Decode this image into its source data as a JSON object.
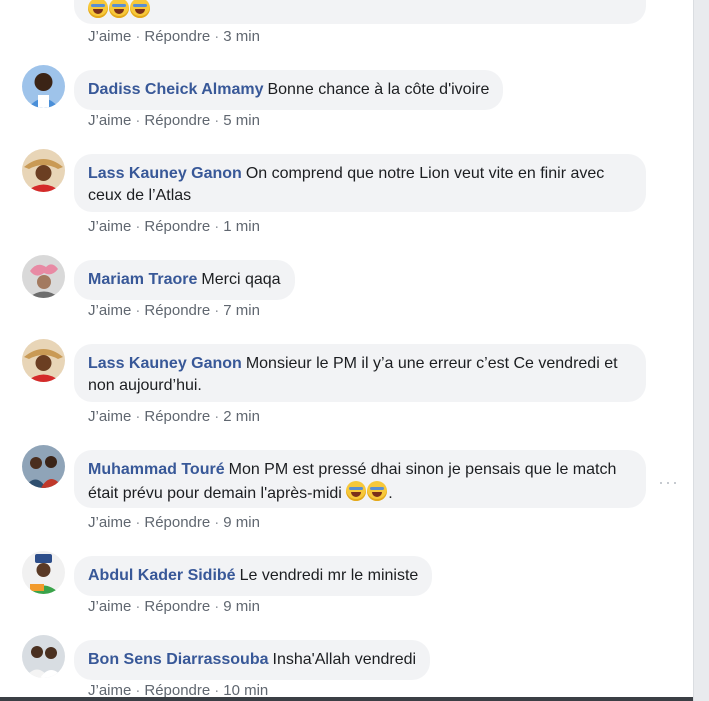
{
  "actions": {
    "like": "J’aime",
    "reply": "Répondre",
    "separator": "·"
  },
  "comments": [
    {
      "author": "",
      "text": "",
      "time": "3 min"
    },
    {
      "author": "Dadiss Cheick Almamy",
      "text": "Bonne chance à la côte d'ivoire",
      "time": "5 min"
    },
    {
      "author": "Lass Kauney Ganon",
      "text": "On comprend que notre Lion veut vite en finir avec ceux de l’Atlas",
      "time": "1 min"
    },
    {
      "author": "Mariam Traore",
      "text": "Merci qaqa",
      "time": "7 min"
    },
    {
      "author": "Lass Kauney Ganon",
      "text": "Monsieur le PM il y’a une erreur c’est Ce vendredi et non aujourd’hui.",
      "time": "2 min"
    },
    {
      "author": "Muhammad Touré",
      "text": "Mon PM est pressé dhai sinon je pensais que le match était prévu pour demain l'après-midi",
      "text_end": ".",
      "time": "9 min"
    },
    {
      "author": "Abdul Kader Sidibé",
      "text": "Le vendredi mr le ministe",
      "time": "9 min"
    },
    {
      "author": "Bon Sens Diarrassouba",
      "text": "Insha'Allah vendredi",
      "time": "10 min"
    }
  ],
  "more_options": "···",
  "colors": {
    "name": "#385898",
    "bubble": "#f2f3f5",
    "meta": "#606770",
    "text": "#1c1e21"
  }
}
